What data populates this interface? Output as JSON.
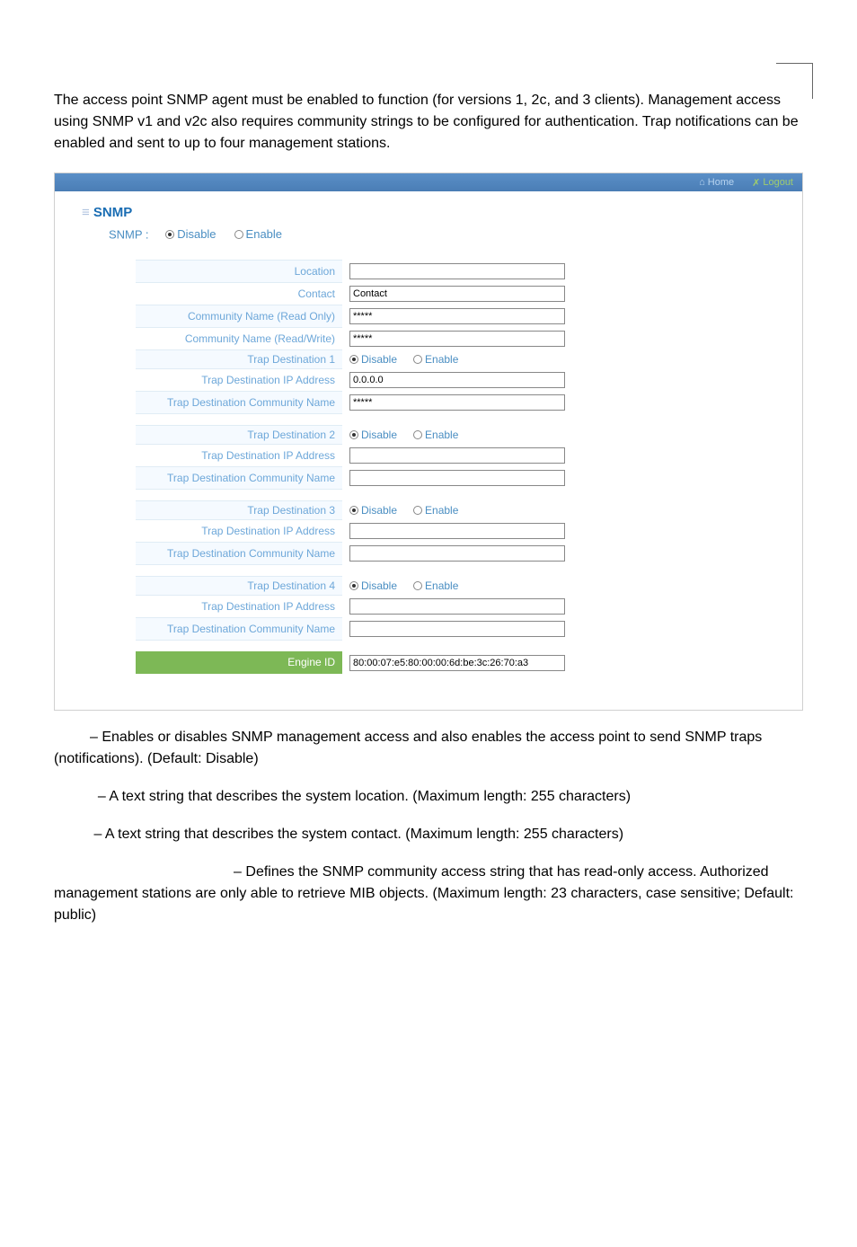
{
  "intro": "The access point  SNMP agent must be enabled to function (for versions 1, 2c, and 3 clients). Management access using SNMP v1 and v2c also requires community strings to be configured for authentication. Trap notifications can be enabled and sent to up to four management stations.",
  "topbar": {
    "home": "Home",
    "logout": "Logout"
  },
  "section_title": "SNMP",
  "snmp_label": "SNMP :",
  "radio_disable": "Disable",
  "radio_enable": "Enable",
  "labels": {
    "location": "Location",
    "contact": "Contact",
    "comm_ro": "Community Name (Read Only)",
    "comm_rw": "Community Name (Read/Write)",
    "trap1": "Trap Destination 1",
    "trap1_ip": "Trap Destination IP Address",
    "trap1_comm": "Trap Destination Community Name",
    "trap2": "Trap Destination 2",
    "trap2_ip": "Trap Destination IP Address",
    "trap2_comm": "Trap Destination Community Name",
    "trap3": "Trap Destination 3",
    "trap3_ip": "Trap Destination IP Address",
    "trap3_comm": "Trap Destination Community Name",
    "trap4": "Trap Destination 4",
    "trap4_ip": "Trap Destination IP Address",
    "trap4_comm": "Trap Destination Community Name",
    "engine_id": "Engine ID"
  },
  "values": {
    "location": "",
    "contact": "Contact",
    "comm_ro": "*****",
    "comm_rw": "*****",
    "trap1_ip": "0.0.0.0",
    "trap1_comm": "*****",
    "trap2_ip": "",
    "trap2_comm": "",
    "trap3_ip": "",
    "trap3_comm": "",
    "trap4_ip": "",
    "trap4_comm": "",
    "engine_id": "80:00:07:e5:80:00:00:6d:be:3c:26:70:a3"
  },
  "desc": {
    "snmp": " – Enables or disables SNMP management access and also enables the access point to send SNMP traps (notifications). (Default: Disable)",
    "location": " – A text string that describes the system location. (Maximum length: 255 characters)",
    "contact": " – A text string that describes the system contact. (Maximum length: 255 characters)",
    "comm_ro": " – Defines the SNMP community access string that has read-only access. Authorized management stations are only able to retrieve MIB objects. (Maximum length: 23 characters, case sensitive; Default: public)"
  }
}
